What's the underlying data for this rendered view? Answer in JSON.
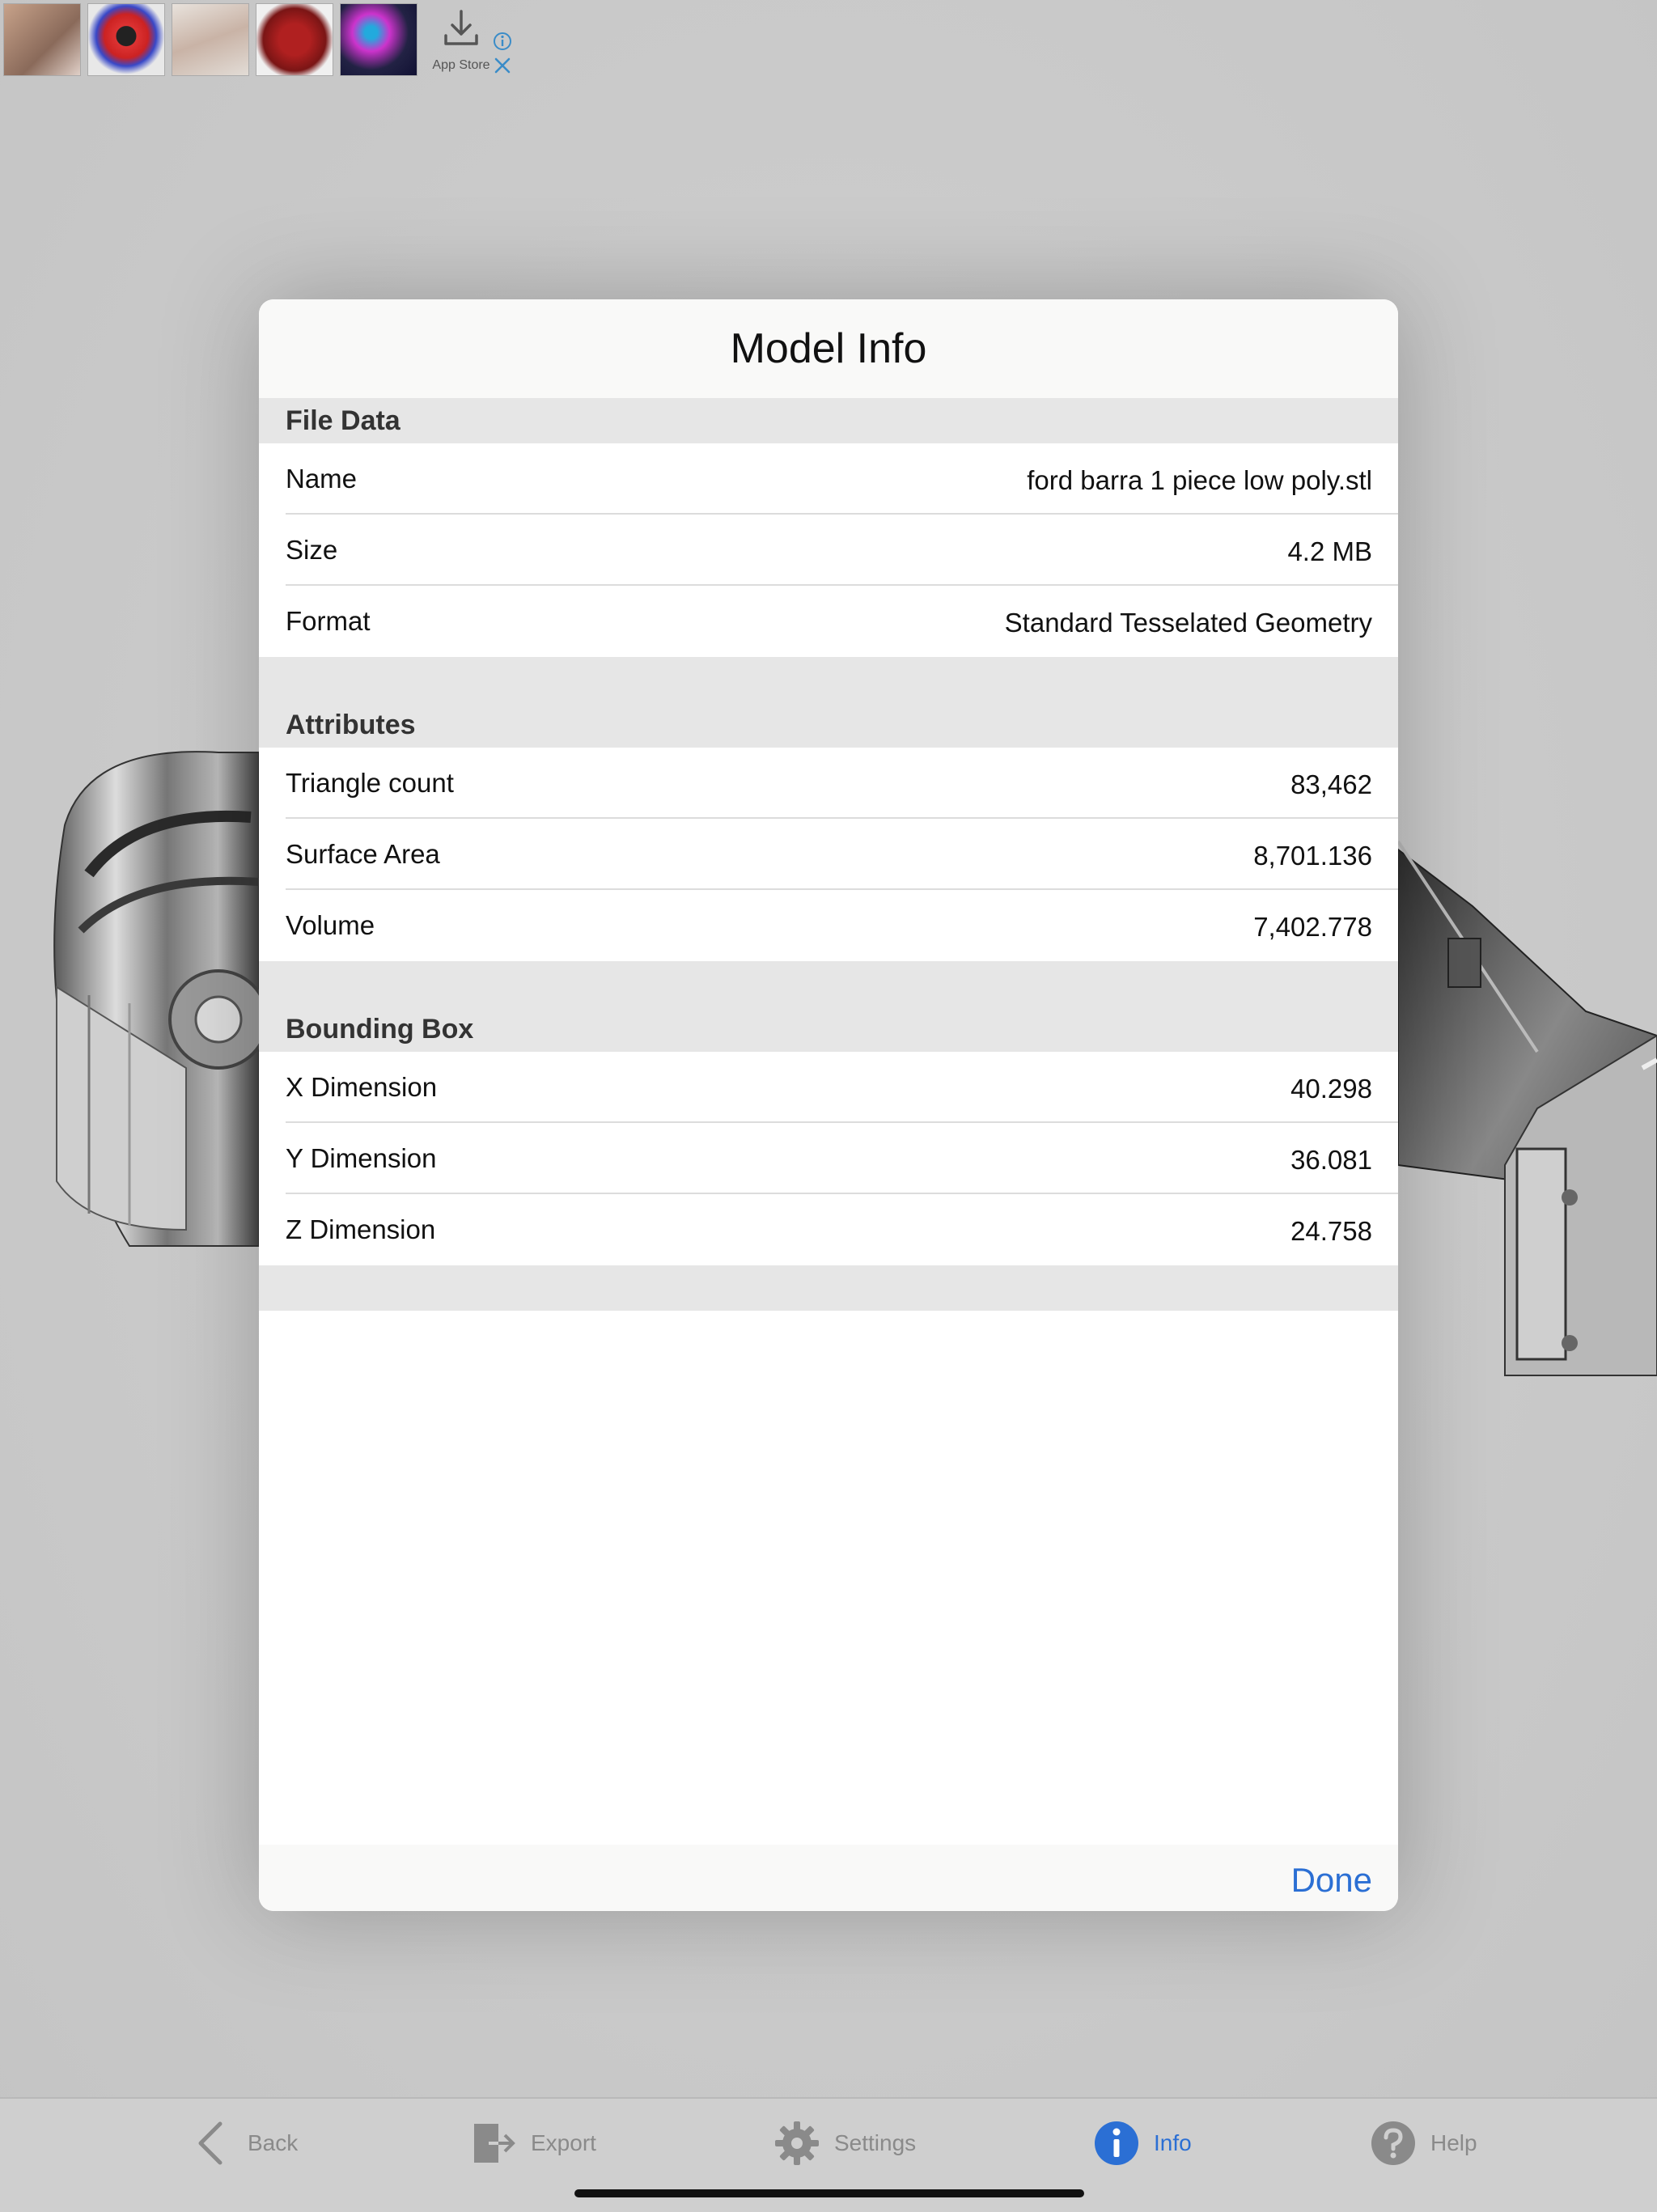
{
  "ad_banner": {
    "store_label": "App Store"
  },
  "modal": {
    "title": "Model Info",
    "sections": [
      {
        "header": "File Data",
        "rows": [
          {
            "label": "Name",
            "value": "ford barra 1 piece low poly.stl"
          },
          {
            "label": "Size",
            "value": "4.2 MB"
          },
          {
            "label": "Format",
            "value": "Standard Tesselated Geometry"
          }
        ]
      },
      {
        "header": "Attributes",
        "rows": [
          {
            "label": "Triangle count",
            "value": "83,462"
          },
          {
            "label": "Surface Area",
            "value": "8,701.136"
          },
          {
            "label": "Volume",
            "value": "7,402.778"
          }
        ]
      },
      {
        "header": "Bounding Box",
        "rows": [
          {
            "label": "X Dimension",
            "value": "40.298"
          },
          {
            "label": "Y Dimension",
            "value": "36.081"
          },
          {
            "label": "Z Dimension",
            "value": "24.758"
          }
        ]
      }
    ],
    "done_label": "Done"
  },
  "tab_bar": {
    "tabs": [
      {
        "label": "Back",
        "icon": "chevron-left-icon"
      },
      {
        "label": "Export",
        "icon": "export-icon"
      },
      {
        "label": "Settings",
        "icon": "gear-icon"
      },
      {
        "label": "Info",
        "icon": "info-icon",
        "active": true
      },
      {
        "label": "Help",
        "icon": "question-icon"
      }
    ]
  },
  "colors": {
    "accent": "#2b6fd4",
    "section_bg": "#e6e6e6",
    "backdrop": "#c9c9c9"
  }
}
